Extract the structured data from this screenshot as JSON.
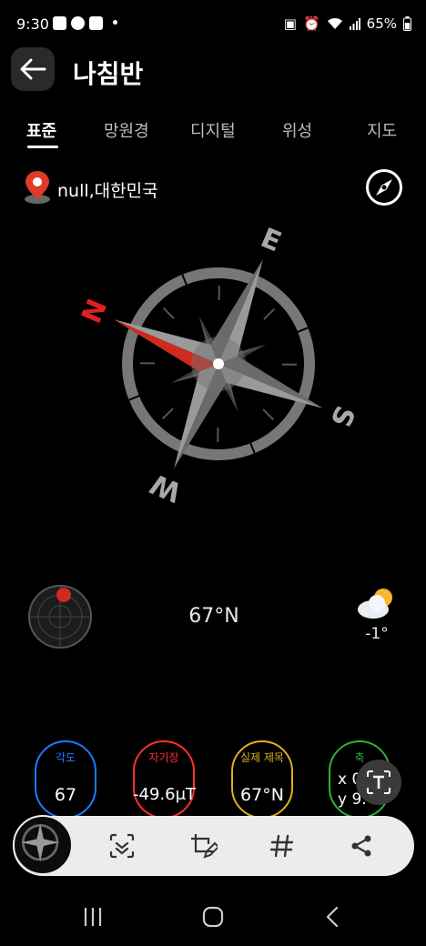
{
  "status_bar": {
    "time": "9:30",
    "battery": "65%"
  },
  "header": {
    "title": "나침반"
  },
  "tabs": [
    {
      "label": "표준"
    },
    {
      "label": "망원경"
    },
    {
      "label": "디지털"
    },
    {
      "label": "위성"
    },
    {
      "label": "지도"
    }
  ],
  "location": {
    "text": "null,대한민국"
  },
  "compass": {
    "north": "N",
    "east": "E",
    "south": "S",
    "west": "W",
    "rotation_deg": -67
  },
  "readout": {
    "direction": "67°N",
    "temperature": "-1°"
  },
  "cards": [
    {
      "label": "각도",
      "value": "67",
      "color": "#1e7bff"
    },
    {
      "label": "자기장",
      "value": "-49.6μT",
      "color": "#ff3030"
    },
    {
      "label": "실제 제목",
      "value": "67°N",
      "color": "#e0b020"
    },
    {
      "label": "축",
      "value": "x 0",
      "value2": "y 9.",
      "color": "#2fb040"
    }
  ],
  "colors": {
    "accent_red": "#e02020",
    "toolbar_bg": "#ececec"
  },
  "toolbar_icons": [
    "scan-icon",
    "crop-edit-icon",
    "hashtag-icon",
    "share-icon"
  ]
}
